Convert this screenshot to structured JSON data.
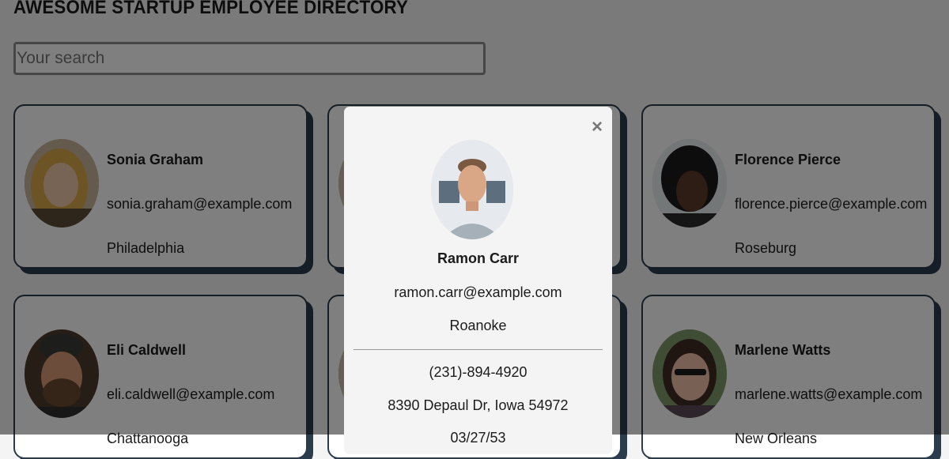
{
  "header": {
    "title": "AWESOME STARTUP EMPLOYEE DIRECTORY"
  },
  "search": {
    "placeholder": "Your search",
    "value": ""
  },
  "employees": [
    {
      "name": "Sonia Graham",
      "email": "sonia.graham@example.com",
      "city": "Philadelphia"
    },
    {
      "name": "",
      "email": "",
      "city": ""
    },
    {
      "name": "Florence Pierce",
      "email": "florence.pierce@example.com",
      "city": "Roseburg"
    },
    {
      "name": "Eli Caldwell",
      "email": "eli.caldwell@example.com",
      "city": "Chattanooga"
    },
    {
      "name": "",
      "email": "",
      "city": ""
    },
    {
      "name": "Marlene Watts",
      "email": "marlene.watts@example.com",
      "city": "New Orleans"
    }
  ],
  "modal": {
    "close_label": "×",
    "name": "Ramon Carr",
    "email": "ramon.carr@example.com",
    "city": "Roanoke",
    "phone": "(231)-894-4920",
    "address": "8390 Depaul Dr, Iowa 54972",
    "birthday": "03/27/53"
  }
}
